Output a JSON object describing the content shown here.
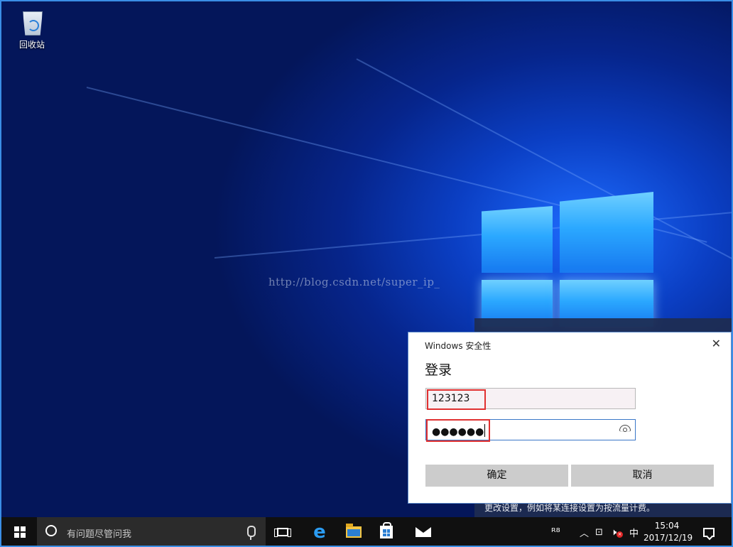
{
  "desktop": {
    "recycle_bin_label": "回收站",
    "watermark": "http://blog.csdn.net/super_ip_"
  },
  "notification": {
    "text": "更改设置，例如将某连接设置为按流量计费。"
  },
  "dialog": {
    "title": "Windows 安全性",
    "close_glyph": "✕",
    "heading": "登录",
    "username_value": "123123",
    "password_value": "●●●●●●",
    "ok_label": "确定",
    "cancel_label": "取消"
  },
  "taskbar": {
    "search_placeholder": "有问题尽管问我",
    "edge_glyph": "e",
    "tray": {
      "people_glyph": "ᴿ⁸",
      "chevron_glyph": "︿",
      "network_glyph": "⊡",
      "volume_glyph": "🕨",
      "ime_label": "中",
      "time": "15:04",
      "date": "2017/12/19"
    }
  },
  "icons": [
    "recycle-bin-icon",
    "windows-start-icon",
    "cortana-icon",
    "mic-icon",
    "task-view-icon",
    "edge-icon",
    "file-explorer-icon",
    "store-icon",
    "mail-icon",
    "people-icon",
    "network-icon",
    "volume-icon",
    "action-center-icon",
    "password-reveal-icon",
    "close-icon"
  ],
  "colors": {
    "highlight_box": "#e03030",
    "taskbar": "#101010",
    "edge_blue": "#2b9cf2"
  }
}
